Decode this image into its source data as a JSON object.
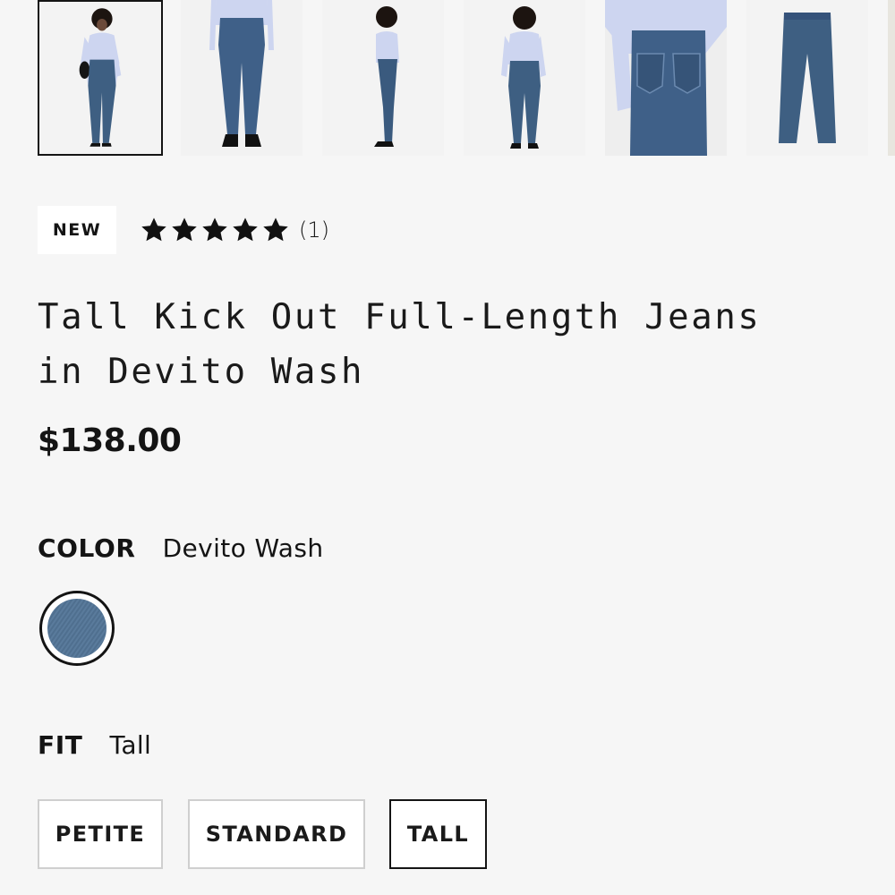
{
  "gallery": {
    "thumbnails": [
      {
        "name": "front-view-with-bag",
        "selected": true
      },
      {
        "name": "front-view-close"
      },
      {
        "name": "side-view"
      },
      {
        "name": "back-view"
      },
      {
        "name": "back-pocket-detail"
      },
      {
        "name": "flat-lay"
      }
    ]
  },
  "product": {
    "badge": "NEW",
    "rating": {
      "stars": 5,
      "count_label": "(1)"
    },
    "title_line1": "Tall Kick Out Full-Length Jeans",
    "title_line2": "in Devito Wash",
    "price": "$138.00"
  },
  "color": {
    "label": "COLOR",
    "value": "Devito Wash",
    "swatch_color": "#4f6f8f"
  },
  "fit": {
    "label": "FIT",
    "value": "Tall",
    "options": [
      {
        "label": "PETITE"
      },
      {
        "label": "STANDARD"
      },
      {
        "label": "TALL",
        "selected": true
      }
    ]
  },
  "colors": {
    "text": "#141414",
    "background": "#f6f6f6",
    "denim": "#3e5f82",
    "shirt": "#c9d2ef"
  }
}
